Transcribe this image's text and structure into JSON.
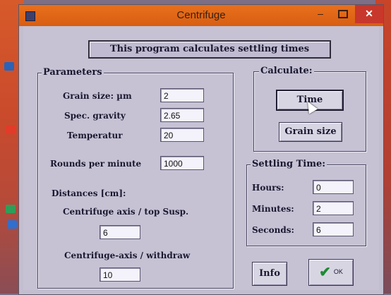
{
  "window": {
    "title": "Centrifuge",
    "minimize_glyph": "–",
    "close_glyph": "✕"
  },
  "banner": "This program calculates settling times",
  "parameters": {
    "title": "Parameters",
    "grain_size_label": "Grain size: µm",
    "grain_size_value": "2",
    "spec_gravity_label": "Spec. gravity",
    "spec_gravity_value": "2.65",
    "temperature_label": "Temperatur",
    "temperature_value": "20",
    "rpm_label": "Rounds per minute",
    "rpm_value": "1000",
    "distances_label": "Distances [cm]:",
    "axis_top_label": "Centrifuge axis / top Susp.",
    "axis_top_value": "6",
    "axis_withdraw_label": "Centrifuge-axis / withdraw",
    "axis_withdraw_value": "10"
  },
  "calculate": {
    "title": "Calculate:",
    "time_button": "Time",
    "grain_size_button": "Grain size"
  },
  "settling": {
    "title": "Settling Time:",
    "hours_label": "Hours:",
    "hours_value": "0",
    "minutes_label": "Minutes:",
    "minutes_value": "2",
    "seconds_label": "Seconds:",
    "seconds_value": "6"
  },
  "footer": {
    "info_button": "Info",
    "ok_button": "OK"
  },
  "colors": {
    "titlebar": "#e8701c",
    "close": "#c8372b",
    "window_bg": "#c6c2d4",
    "ok_check": "#1e8a32"
  }
}
